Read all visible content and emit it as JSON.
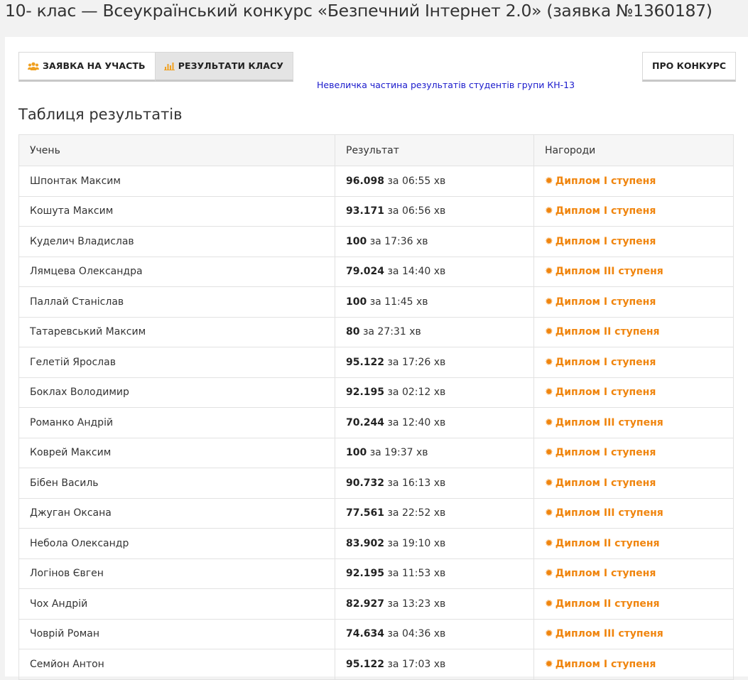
{
  "header": {
    "title": "10- клас — Всеукраїнський конкурс «Безпечний Інтернет 2.0» (заявка №1360187)"
  },
  "tabs": [
    {
      "label": "ЗАЯВКА НА УЧАСТЬ",
      "icon": "users-icon",
      "active": false
    },
    {
      "label": "РЕЗУЛЬТАТИ КЛАСУ",
      "icon": "bar-chart-icon",
      "active": true
    }
  ],
  "about_button": {
    "label": "ПРО КОНКУРС"
  },
  "note": "Невеличка частина результатів студентів групи КН-13",
  "section_title": "Таблиця результатів",
  "colors": {
    "award": "#f0850e",
    "note": "#1a1acc",
    "active_tab": "#e4e4e4"
  },
  "table": {
    "columns": [
      "Учень",
      "Результат",
      "Нагороди"
    ],
    "rows": [
      {
        "name": "Шпонтак Максим",
        "score": "96.098",
        "time": "за 06:55 хв",
        "award": "Диплом I ступеня"
      },
      {
        "name": "Кошута Максим",
        "score": "93.171",
        "time": "за 06:56 хв",
        "award": "Диплом I ступеня"
      },
      {
        "name": "Куделич Владислав",
        "score": "100",
        "time": "за 17:36 хв",
        "award": "Диплом I ступеня"
      },
      {
        "name": "Лямцева Олександра",
        "score": "79.024",
        "time": "за 14:40 хв",
        "award": "Диплом III ступеня"
      },
      {
        "name": "Паллай Станіслав",
        "score": "100",
        "time": "за 11:45 хв",
        "award": "Диплом I ступеня"
      },
      {
        "name": "Татаревський Максим",
        "score": "80",
        "time": "за 27:31 хв",
        "award": "Диплом II ступеня"
      },
      {
        "name": "Гелетій Ярослав",
        "score": "95.122",
        "time": "за 17:26 хв",
        "award": "Диплом I ступеня"
      },
      {
        "name": "Боклах Володимир",
        "score": "92.195",
        "time": "за 02:12 хв",
        "award": "Диплом I ступеня"
      },
      {
        "name": "Романко Андрій",
        "score": "70.244",
        "time": "за 12:40 хв",
        "award": "Диплом III ступеня"
      },
      {
        "name": "Коврей Максим",
        "score": "100",
        "time": "за 19:37 хв",
        "award": "Диплом I ступеня"
      },
      {
        "name": "Бібен Василь",
        "score": "90.732",
        "time": "за 16:13 хв",
        "award": "Диплом I ступеня"
      },
      {
        "name": "Джуган Оксана",
        "score": "77.561",
        "time": "за 22:52 хв",
        "award": "Диплом III ступеня"
      },
      {
        "name": "Небола Олександр",
        "score": "83.902",
        "time": "за 19:10 хв",
        "award": "Диплом II ступеня"
      },
      {
        "name": "Логінов Євген",
        "score": "92.195",
        "time": "за 11:53 хв",
        "award": "Диплом I ступеня"
      },
      {
        "name": "Чох Андрій",
        "score": "82.927",
        "time": "за 13:23 хв",
        "award": "Диплом II ступеня"
      },
      {
        "name": "Човрій Роман",
        "score": "74.634",
        "time": "за 04:36 хв",
        "award": "Диплом III ступеня"
      },
      {
        "name": "Семйон Антон",
        "score": "95.122",
        "time": "за 17:03 хв",
        "award": "Диплом I ступеня"
      }
    ]
  }
}
